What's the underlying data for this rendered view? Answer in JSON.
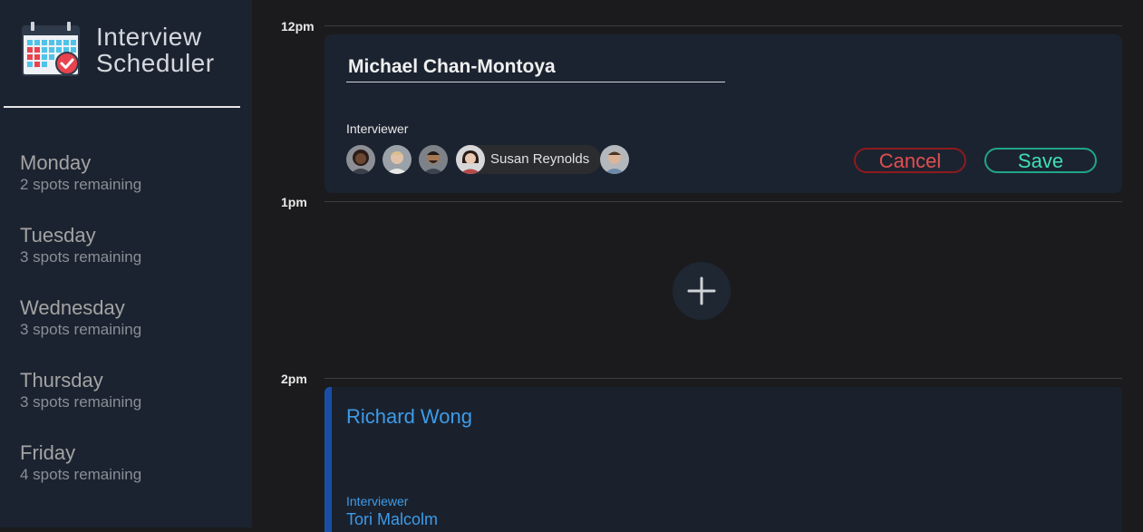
{
  "app": {
    "title_line1": "Interview",
    "title_line2": "Scheduler",
    "logo_icon": "calendar-check-icon"
  },
  "sidebar": {
    "days": [
      {
        "name": "Monday",
        "spots": "2 spots remaining"
      },
      {
        "name": "Tuesday",
        "spots": "3 spots remaining"
      },
      {
        "name": "Wednesday",
        "spots": "3 spots remaining"
      },
      {
        "name": "Thursday",
        "spots": "3 spots remaining"
      },
      {
        "name": "Friday",
        "spots": "4 spots remaining"
      }
    ]
  },
  "schedule": {
    "times": [
      "12pm",
      "1pm",
      "2pm"
    ],
    "edit_form": {
      "student_name": "Michael Chan-Montoya",
      "interviewer_label": "Interviewer",
      "selected_interviewer": "Susan Reynolds",
      "cancel_label": "Cancel",
      "save_label": "Save"
    },
    "add_icon": "plus-icon",
    "booked": {
      "student": "Richard Wong",
      "interviewer_label": "Interviewer",
      "interviewer": "Tori Malcolm"
    }
  },
  "colors": {
    "sidebar_bg": "#1c2330",
    "main_bg": "#1b1b1d",
    "cancel": "#e05050",
    "save": "#3fe0b6",
    "booked_accent": "#3d9be9"
  }
}
